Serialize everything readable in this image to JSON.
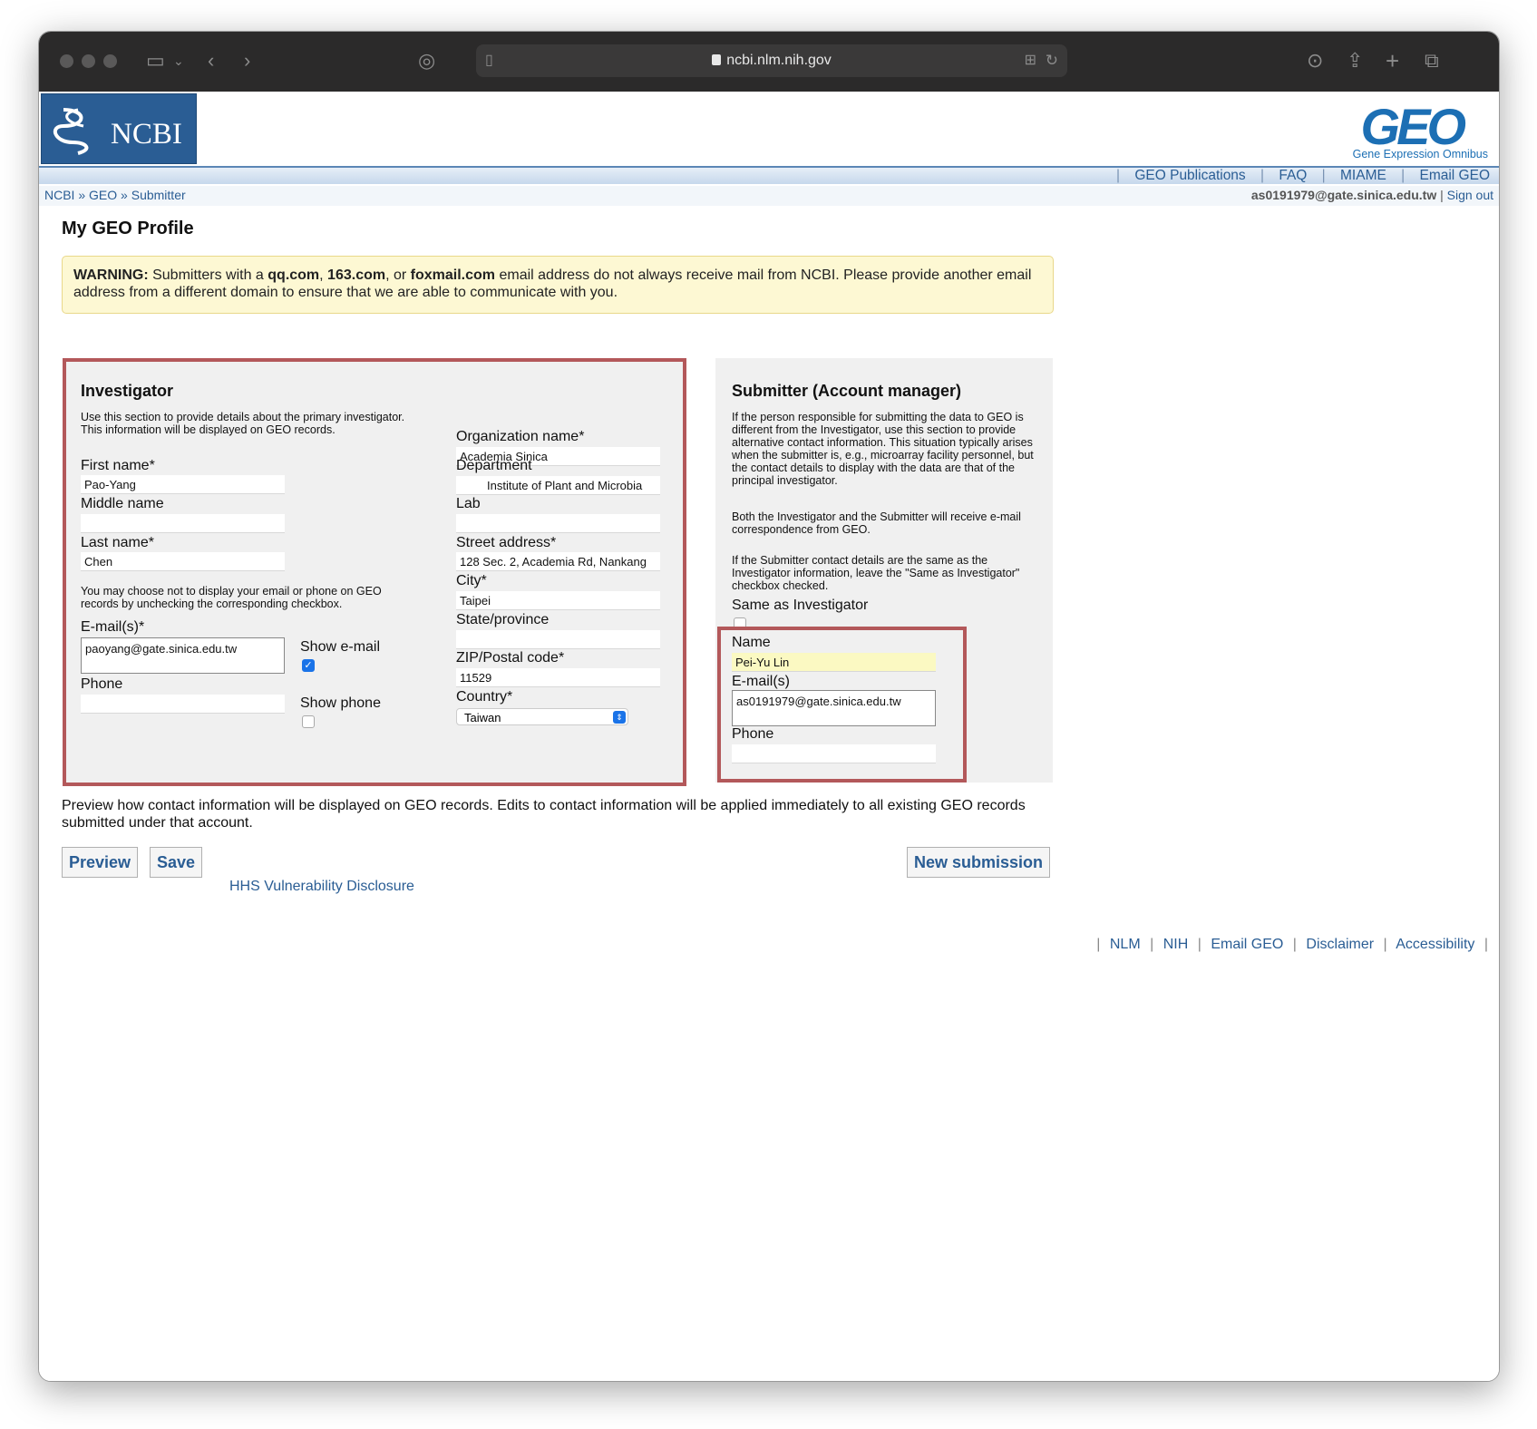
{
  "browser": {
    "url": "ncbi.nlm.nih.gov"
  },
  "header": {
    "ncbi_logo_text": "NCBI",
    "geo_logo_text": "GEO",
    "geo_logo_sub": "Gene Expression Omnibus",
    "nav": [
      "GEO Publications",
      "FAQ",
      "MIAME",
      "Email GEO"
    ]
  },
  "breadcrumb": [
    "NCBI",
    "GEO",
    "Submitter"
  ],
  "breadcrumb_sep": "»",
  "user": {
    "email": "as0191979@gate.sinica.edu.tw",
    "signout": "Sign out",
    "sep": "|"
  },
  "page_title": "My GEO Profile",
  "warning": {
    "label": "WARNING:",
    "t1": " Submitters with a ",
    "d1": "qq.com",
    "t2": ", ",
    "d2": "163.com",
    "t3": ", or ",
    "d3": "foxmail.com",
    "t4": " email address do not always receive mail from NCBI. Please provide another email address from a different domain to ensure that we are able to communicate with you."
  },
  "investigator": {
    "title": "Investigator",
    "intro": "Use this section to provide details about the primary investigator. This information will be displayed on GEO records.",
    "first_name_label": "First name*",
    "first_name": "Pao-Yang",
    "middle_name_label": "Middle name",
    "middle_name": "",
    "last_name_label": "Last name*",
    "last_name": "Chen",
    "privacy_note": "You may choose not to display your email or phone on GEO records by unchecking the corresponding checkbox.",
    "email_label": "E-mail(s)*",
    "email": "paoyang@gate.sinica.edu.tw",
    "show_email_label": "Show e-mail",
    "show_email_check": "✓",
    "phone_label": "Phone",
    "phone": "",
    "show_phone_label": "Show phone",
    "org_label": "Organization name*",
    "org": "Academia Sinica",
    "dept_label": "Department",
    "dept": "Institute of Plant and Microbia",
    "lab_label": "Lab",
    "lab": "",
    "street_label": "Street address*",
    "street": "128 Sec. 2, Academia Rd, Nankang",
    "city_label": "City*",
    "city": "Taipei",
    "state_label": "State/province",
    "state": "",
    "zip_label": "ZIP/Postal code*",
    "zip": "11529",
    "country_label": "Country*",
    "country": "Taiwan"
  },
  "submitter": {
    "title": "Submitter (Account manager)",
    "p1": "If the person responsible for submitting the data to GEO is different from the Investigator, use this section to provide alternative contact information. This situation typically arises when the submitter is, e.g., microarray facility personnel, but the contact details to display with the data are that of the principal investigator.",
    "p2": "Both the Investigator and the Submitter will receive e-mail correspondence from GEO.",
    "p3": "If the Submitter contact details are the same as the Investigator information, leave the \"Same as Investigator\" checkbox checked.",
    "same_label": "Same as Investigator",
    "name_label": "Name",
    "name": "Pei-Yu Lin",
    "email_label": "E-mail(s)",
    "email": "as0191979@gate.sinica.edu.tw",
    "phone_label": "Phone",
    "phone": ""
  },
  "preview_note": "Preview how contact information will be displayed on GEO records. Edits to contact information will be applied immediately to all existing GEO records submitted under that account.",
  "buttons": {
    "preview": "Preview",
    "save": "Save",
    "new_submission": "New submission"
  },
  "hhs_link": "HHS Vulnerability Disclosure",
  "footer": [
    "NLM",
    "NIH",
    "Email GEO",
    "Disclaimer",
    "Accessibility"
  ],
  "footer_sep": "|",
  "colors": {
    "ncbi_blue": "#2a5d94",
    "warning_bg": "#fdf8d3",
    "highlight_border": "#b3585a",
    "autofill": "#fbf9c2"
  }
}
